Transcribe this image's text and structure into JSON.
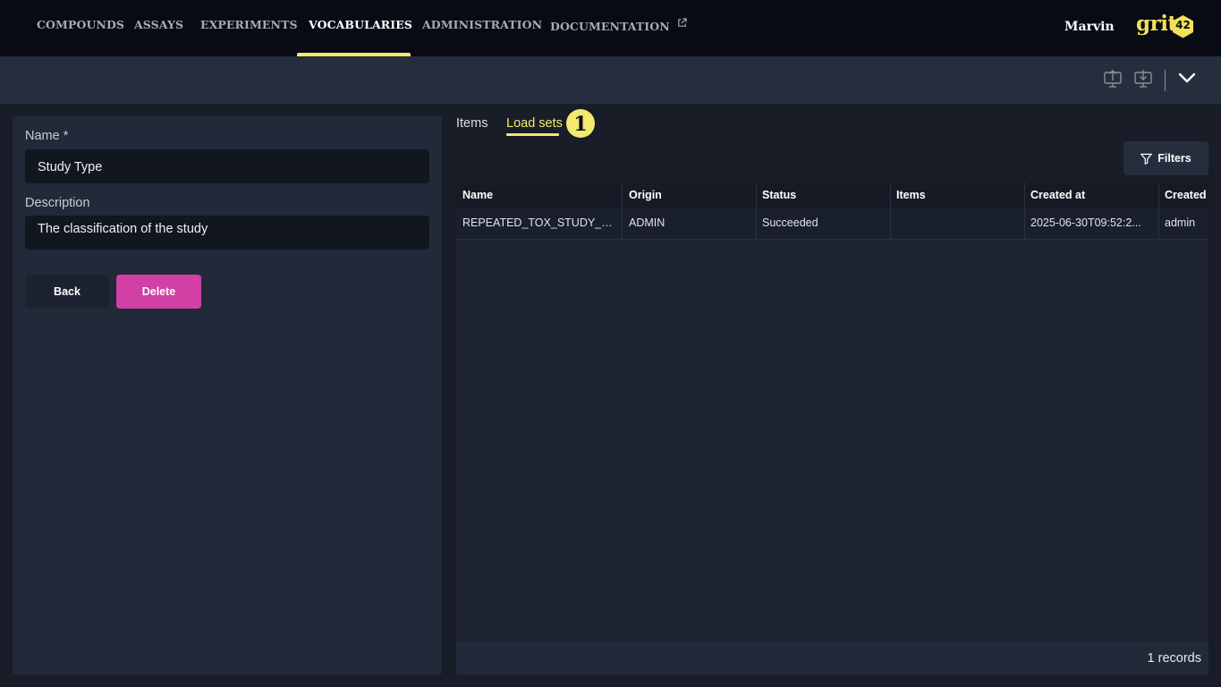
{
  "nav": {
    "items": [
      {
        "label": "COMPOUNDS"
      },
      {
        "label": "ASSAYS"
      },
      {
        "label": "EXPERIMENTS"
      },
      {
        "label": "VOCABULARIES"
      },
      {
        "label": "ADMINISTRATION"
      },
      {
        "label": "DOCUMENTATION"
      }
    ],
    "active": "VOCABULARIES",
    "user": "Marvin",
    "logo_text": "grit",
    "logo_number": "42"
  },
  "toolbar": {
    "icons": [
      "upload-icon",
      "download-icon",
      "chevron-down-icon"
    ]
  },
  "form": {
    "name_label": "Name *",
    "name_value": "Study Type",
    "description_label": "Description",
    "description_value": "The classification of the study",
    "back_label": "Back",
    "delete_label": "Delete"
  },
  "tabs": {
    "items": [
      {
        "label": "Items"
      },
      {
        "label": "Load sets"
      }
    ],
    "active": "Load sets",
    "badge": "1"
  },
  "filters_label": "Filters",
  "table": {
    "columns": [
      "Name",
      "Origin",
      "Status",
      "Items",
      "Created at",
      "Created"
    ],
    "rows": [
      [
        "REPEATED_TOX_STUDY_TYPES",
        "ADMIN",
        "Succeeded",
        "",
        "2025-06-30T09:52:2...",
        "admin"
      ]
    ],
    "records_label": "1 records"
  },
  "colors": {
    "accent": "#f3e96b",
    "delete": "#d23fa5",
    "topbar": "#080b14",
    "background": "#181d28"
  }
}
